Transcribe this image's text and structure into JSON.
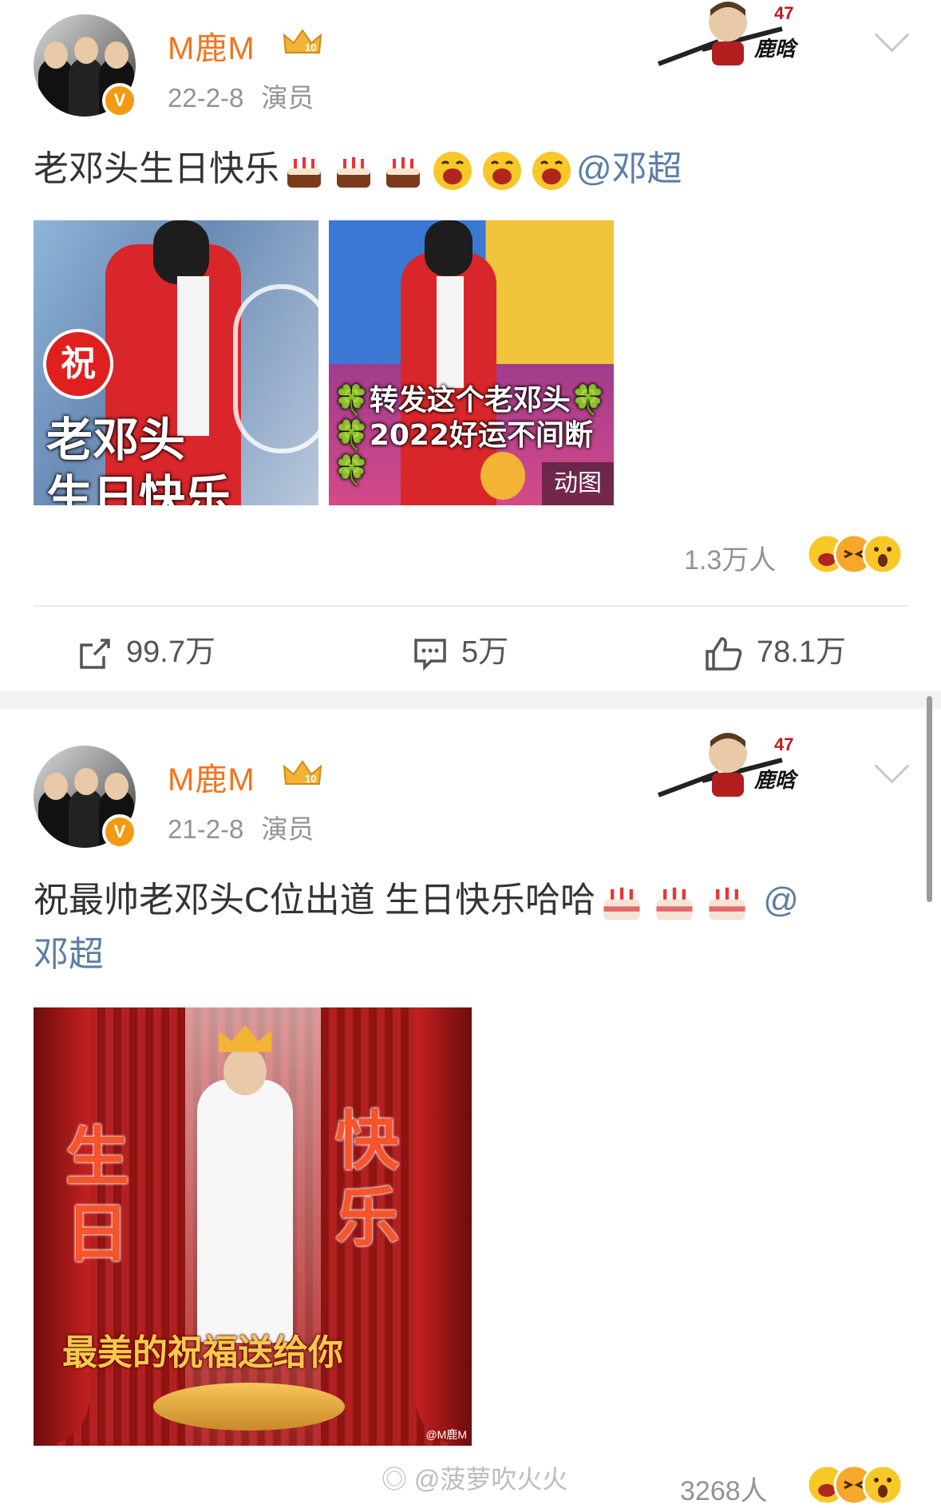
{
  "posts": [
    {
      "username": "M鹿M",
      "date": "22-2-8",
      "role": "演员",
      "text": "老邓头生日快乐",
      "emojis": [
        "cake-icon",
        "cake-icon",
        "cake-icon",
        "laugh-icon",
        "laugh-icon",
        "laugh-icon"
      ],
      "mention": "@邓超",
      "image1": {
        "badge": "祝",
        "line1": "老邓头",
        "line2": "生日快乐"
      },
      "image2": {
        "line1": "转发这个老邓头",
        "line2": "2022好运不间断",
        "gif_label": "动图"
      },
      "reaction_count": "1.3万人",
      "actions": {
        "repost": "99.7万",
        "comment": "5万",
        "like": "78.1万"
      }
    },
    {
      "username": "M鹿M",
      "date": "21-2-8",
      "role": "演员",
      "text": "祝最帅老邓头C位出道  生日快乐哈哈",
      "emojis": [
        "cake-icon",
        "cake-icon",
        "cake-icon"
      ],
      "mention": "@",
      "mention2": "邓超",
      "image": {
        "left_chars": "生日",
        "right_chars": "快乐",
        "banner": "最美的祝福送给你",
        "credit": "@M鹿M"
      },
      "reaction_count": "3268人"
    }
  ],
  "watermark": "@菠萝吹火火",
  "colors": {
    "username": "#f0751e",
    "mention": "#5b7fa6",
    "meta": "#939393",
    "badge": "#f39a15"
  }
}
